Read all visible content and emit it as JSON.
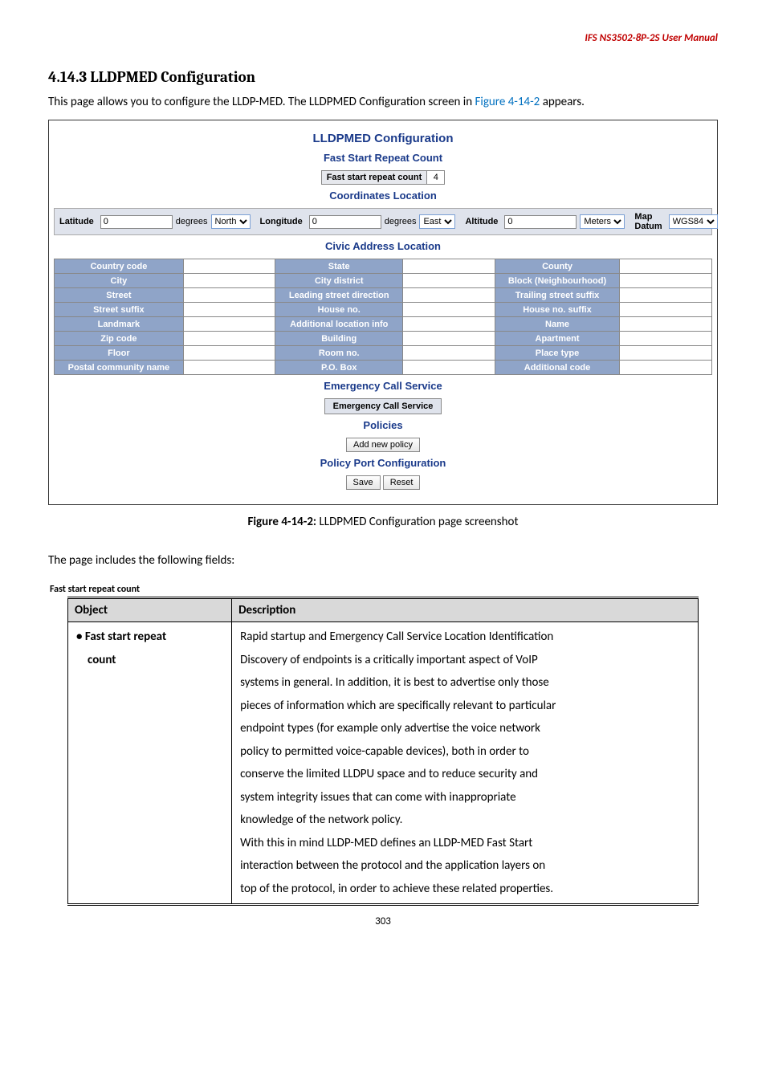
{
  "header": {
    "product": "IFS NS3502-8P-2S  User Manual"
  },
  "section": {
    "number": "4.14.3",
    "title": "LLDPMED Configuration",
    "intro_prefix": "This page allows you to configure the LLDP-MED. The LLDPMED Configuration screen in ",
    "intro_link": "Figure 4-14-2",
    "intro_suffix": " appears."
  },
  "screenshot": {
    "main_title": "LLDPMED Configuration",
    "fast_start": {
      "heading": "Fast Start Repeat Count",
      "label": "Fast start repeat count",
      "value": "4"
    },
    "coords": {
      "heading": "Coordinates Location",
      "latitude_lbl": "Latitude",
      "latitude_val": "0",
      "lat_unit": "degrees",
      "lat_dir": "North",
      "longitude_lbl": "Longitude",
      "longitude_val": "0",
      "lon_unit": "degrees",
      "lon_dir": "East",
      "altitude_lbl": "Altitude",
      "altitude_val": "0",
      "alt_unit": "Meters",
      "map_datum_lbl": "Map Datum",
      "map_datum_val": "WGS84"
    },
    "civic": {
      "heading": "Civic Address Location",
      "rows": [
        [
          "Country code",
          "State",
          "County"
        ],
        [
          "City",
          "City district",
          "Block (Neighbourhood)"
        ],
        [
          "Street",
          "Leading street direction",
          "Trailing street suffix"
        ],
        [
          "Street suffix",
          "House no.",
          "House no. suffix"
        ],
        [
          "Landmark",
          "Additional location info",
          "Name"
        ],
        [
          "Zip code",
          "Building",
          "Apartment"
        ],
        [
          "Floor",
          "Room no.",
          "Place type"
        ],
        [
          "Postal community name",
          "P.O. Box",
          "Additional code"
        ]
      ]
    },
    "emergency": {
      "heading": "Emergency Call Service",
      "box_label": "Emergency Call Service"
    },
    "policies": {
      "heading": "Policies",
      "add_btn": "Add new policy"
    },
    "port_config": {
      "heading": "Policy Port Configuration",
      "save": "Save",
      "reset": "Reset"
    }
  },
  "caption": {
    "bold": "Figure 4-14-2:",
    "rest": " LLDPMED Configuration page screenshot"
  },
  "fields_intro": "The page includes the following fields:",
  "table": {
    "mini_heading": "Fast start repeat count",
    "col_object": "Object",
    "col_desc": "Description",
    "obj_line1": "Fast start repeat",
    "obj_line2": "count",
    "desc_lines": [
      "Rapid startup and Emergency Call Service Location Identification",
      "Discovery of endpoints is a critically important aspect of VoIP",
      "systems in general. In addition, it is best to advertise only those",
      "pieces of information which are specifically relevant to particular",
      "endpoint types (for example only advertise the voice network",
      "policy to permitted voice-capable devices), both in order to",
      "conserve the limited LLDPU space and to reduce security and",
      "system integrity issues that can come with inappropriate",
      "knowledge of the network policy.",
      "With this in mind LLDP-MED defines an LLDP-MED Fast Start",
      "interaction between the protocol and the application layers on",
      "top of the protocol, in order to achieve these related properties."
    ]
  },
  "page_number": "303"
}
